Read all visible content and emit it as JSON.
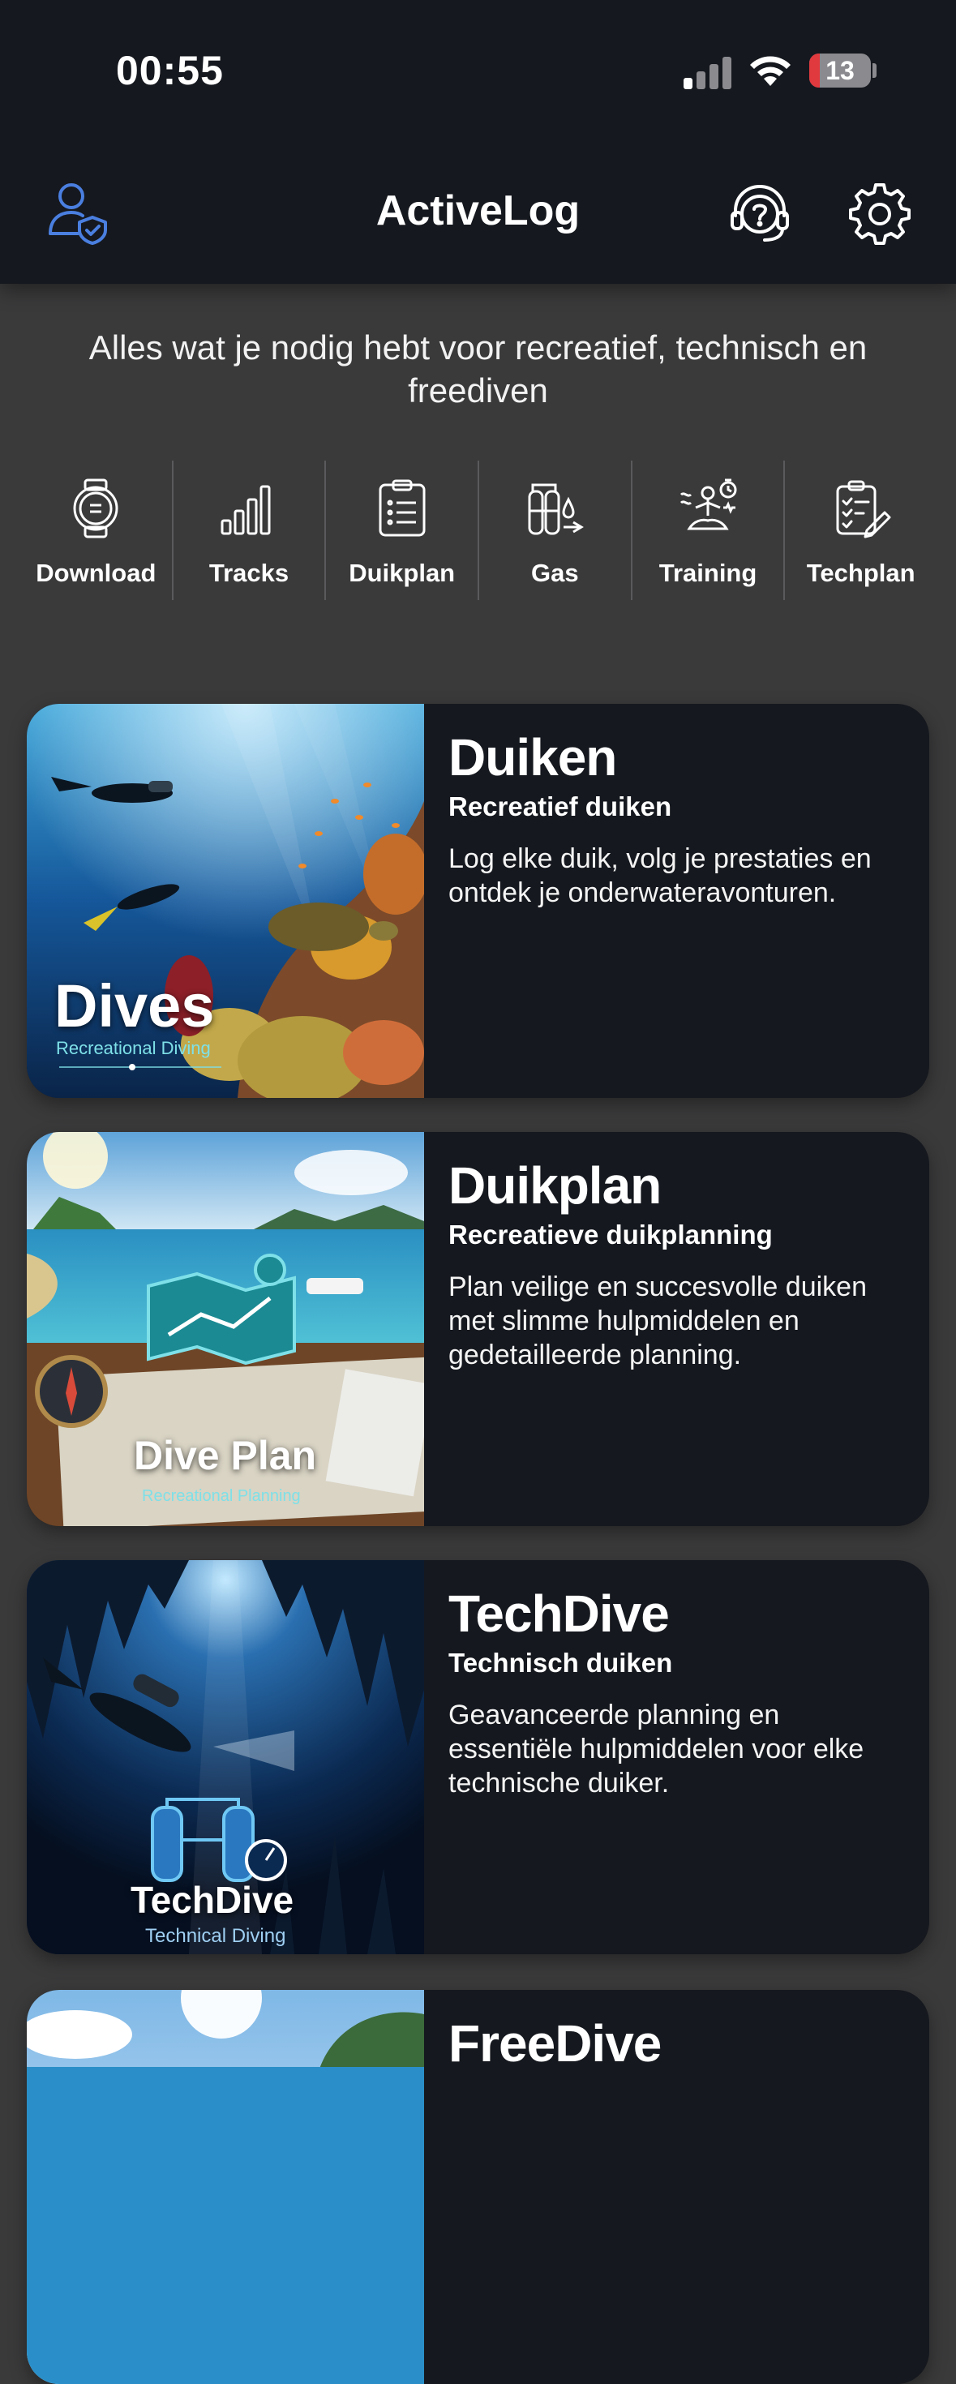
{
  "status_bar": {
    "time": "00:55",
    "battery": "13"
  },
  "header": {
    "title": "ActiveLog"
  },
  "tagline": "Alles wat je nodig hebt voor recreatief, technisch en freediven",
  "quick_actions": [
    {
      "label": "Download",
      "icon": "watch-icon"
    },
    {
      "label": "Tracks",
      "icon": "bar-chart-icon"
    },
    {
      "label": "Duikplan",
      "icon": "clipboard-icon"
    },
    {
      "label": "Gas",
      "icon": "tanks-icon"
    },
    {
      "label": "Training",
      "icon": "meditation-icon"
    },
    {
      "label": "Techplan",
      "icon": "checklist-icon"
    }
  ],
  "cards": [
    {
      "title": "Duiken",
      "subtitle": "Recreatief duiken",
      "description": "Log elke duik, volg je prestaties en ontdek je onderwateravonturen.",
      "image_title": "Dives",
      "image_subtitle": "Recreational Diving"
    },
    {
      "title": "Duikplan",
      "subtitle": "Recreatieve duikplanning",
      "description": "Plan veilige en succesvolle duiken met slimme hulpmiddelen en gedetailleerde planning.",
      "image_title": "Dive Plan",
      "image_subtitle": "Recreational Planning"
    },
    {
      "title": "TechDive",
      "subtitle": "Technisch duiken",
      "description": "Geavanceerde planning en essentiële hulpmiddelen voor elke technische duiker.",
      "image_title": "TechDive",
      "image_subtitle": "Technical Diving"
    },
    {
      "title": "FreeDive"
    }
  ],
  "colors": {
    "accent": "#4a7fe0",
    "card_bg": "#15181e",
    "page_bg": "#3a3a3b",
    "image_sub": "#7ee0e8"
  }
}
